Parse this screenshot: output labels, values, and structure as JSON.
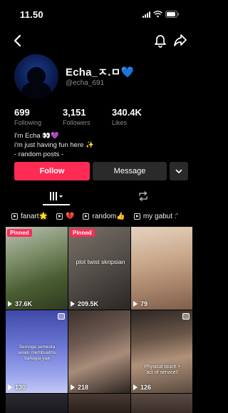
{
  "status": {
    "time": "11.50"
  },
  "profile": {
    "display_name": "Echa_ㅈ.ㅁ💙",
    "username": "@echa_691"
  },
  "stats": [
    {
      "value": "699",
      "label": "Following"
    },
    {
      "value": "3,151",
      "label": "Followers"
    },
    {
      "value": "340.4K",
      "label": "Likes"
    }
  ],
  "bio": {
    "line1": "I'm Echa 👀💜",
    "line2": "i'm just having fun here ✨",
    "line3": "- random posts -"
  },
  "buttons": {
    "follow": "Follow",
    "message": "Message"
  },
  "playlists": [
    {
      "label": "fanart🌟"
    },
    {
      "label": "💔"
    },
    {
      "label": "random👍"
    },
    {
      "label": "my gabut :'"
    }
  ],
  "videos": [
    {
      "views": "37.6K",
      "pinned": "Pinned",
      "overlay": ""
    },
    {
      "views": "209.5K",
      "pinned": "Pinned",
      "overlay": "plot twist skripsian"
    },
    {
      "views": "79",
      "pinned": "",
      "overlay": ""
    },
    {
      "views": "130",
      "pinned": "",
      "overlay": "Semoga semesta selalu membuatmu bahagia yaa"
    },
    {
      "views": "218",
      "pinned": "",
      "overlay": ""
    },
    {
      "views": "126",
      "pinned": "",
      "overlay": "Physical touch + act of service!!"
    }
  ],
  "colors": {
    "accent": "#fe2c55",
    "background": "#000000",
    "muted": "#8a8a8a"
  },
  "icons": [
    "back-arrow-icon",
    "bell-icon",
    "share-icon",
    "chevron-down-icon",
    "grid-icon",
    "repost-icon",
    "playlist-icon",
    "play-icon"
  ]
}
